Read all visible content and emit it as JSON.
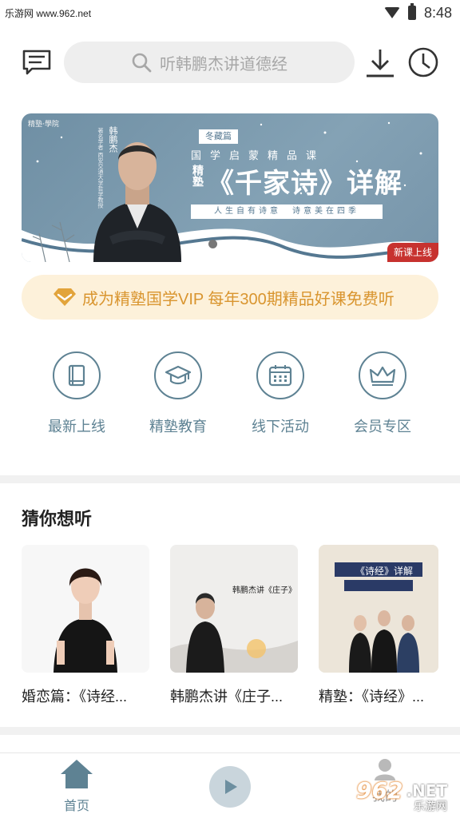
{
  "status_bar": {
    "watermark": "乐游网 www.962.net",
    "time": "8:48"
  },
  "header": {
    "message_icon": "message-icon",
    "search_placeholder": "听韩鹏杰讲道德经",
    "download_icon": "download-icon",
    "history_icon": "history-clock-icon"
  },
  "banner": {
    "brand": "精塾·學院",
    "person_name": "韩鹏杰",
    "person_title": "著名学者 西安交通大学哲学教授",
    "season_tag": "冬藏篇",
    "subtitle": "国学启蒙精品课",
    "side_label": "精塾",
    "main_title": "《千家诗》详解",
    "slogan": "人生自有诗意　诗意美在四季",
    "badge": "新课上线",
    "dots_count": 3,
    "active_dot": 0
  },
  "vip": {
    "icon": "diamond-icon",
    "text": "成为精塾国学VIP 每年300期精品好课免费听",
    "color": "#d9952f"
  },
  "categories": [
    {
      "label": "最新上线",
      "icon": "new-book-icon"
    },
    {
      "label": "精塾教育",
      "icon": "graduation-cap-icon"
    },
    {
      "label": "线下活动",
      "icon": "calendar-icon"
    },
    {
      "label": "会员专区",
      "icon": "crown-icon"
    }
  ],
  "guess": {
    "title": "猜你想听",
    "items": [
      {
        "title": "婚恋篇：《诗经..."
      },
      {
        "title": "韩鹏杰讲《庄子...",
        "thumb_text": "韩鹏杰讲《庄子》"
      },
      {
        "title": "精塾：《诗经》...",
        "thumb_text": "《诗经》详解"
      }
    ]
  },
  "tabbar": {
    "home_label": "首页",
    "play_icon": "play-icon",
    "mine_label": "我的",
    "watermark_number": "962",
    "watermark_suffix": ".NET",
    "watermark_cn": "乐游网"
  },
  "colors": {
    "accent": "#5e8293",
    "vip_bg": "#fdf1da",
    "badge": "#c7322f"
  }
}
